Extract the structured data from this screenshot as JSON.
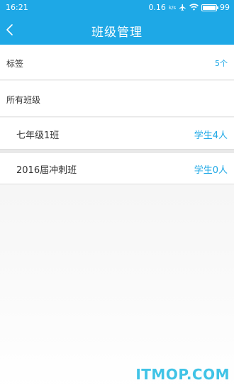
{
  "status_bar": {
    "time": "16:21",
    "speed": "0.16",
    "speed_unit": "k/s",
    "battery": "99",
    "battery_level": 0.99
  },
  "navbar": {
    "title": "班级管理",
    "back_icon": "chevron-left-icon"
  },
  "rows": {
    "tags": {
      "label": "标签",
      "value": "5个"
    },
    "all_classes": {
      "label": "所有班级"
    }
  },
  "classes": [
    {
      "name": "七年级1班",
      "students": "学生4人"
    },
    {
      "name": "2016届冲刺班",
      "students": "学生0人"
    }
  ],
  "watermark": "ITMOP.COM",
  "colors": {
    "accent": "#1ea8e6",
    "watermark": "#40c3e6"
  }
}
